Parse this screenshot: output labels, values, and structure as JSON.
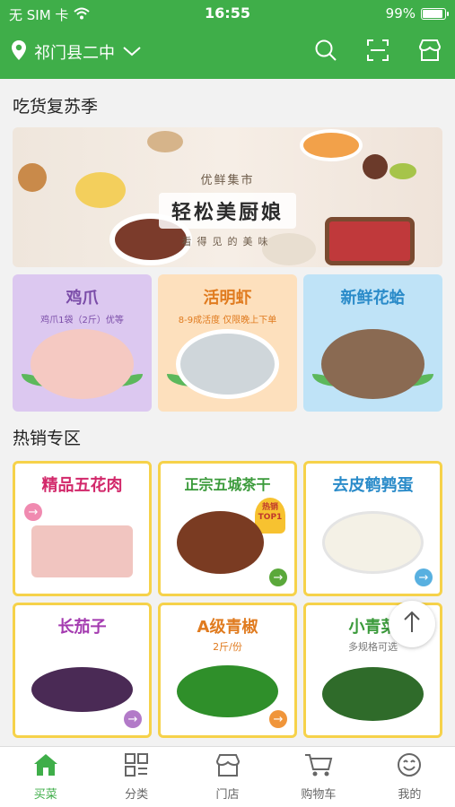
{
  "status_bar": {
    "carrier": "无 SIM 卡",
    "time": "16:55",
    "battery": "99%"
  },
  "header": {
    "location": "祁门县二中"
  },
  "sections": {
    "recommend_title": "吃货复苏季",
    "hot_title": "热销专区"
  },
  "banner": {
    "brand": "优鲜集市",
    "tagline": "轻松美厨娘",
    "subtitle": "看得见的美味"
  },
  "promos": [
    {
      "title": "鸡爪",
      "subtitle": "鸡爪1袋（2斤）优等"
    },
    {
      "title": "活明虾",
      "subtitle": "8-9成活度  仅限晚上下单"
    },
    {
      "title": "新鲜花蛤",
      "subtitle": ""
    }
  ],
  "hot_products": [
    {
      "title": "精品五花肉",
      "subtitle": ""
    },
    {
      "title": "正宗五城茶干",
      "subtitle": "",
      "badge": "热销TOP1"
    },
    {
      "title": "去皮鹌鹑蛋",
      "subtitle": ""
    },
    {
      "title": "长茄子",
      "subtitle": ""
    },
    {
      "title": "A级青椒",
      "subtitle": "2斤/份"
    },
    {
      "title": "小青菜",
      "subtitle": "多规格可选"
    }
  ],
  "tabs": [
    {
      "label": "买菜",
      "icon": "home-icon"
    },
    {
      "label": "分类",
      "icon": "grid-icon"
    },
    {
      "label": "门店",
      "icon": "store-icon"
    },
    {
      "label": "购物车",
      "icon": "cart-icon"
    },
    {
      "label": "我的",
      "icon": "smile-icon"
    }
  ],
  "colors": {
    "brand_green": "#3fae49",
    "card_border": "#f6d24a",
    "promo1_bg": "#dcc8f0",
    "promo2_bg": "#fde0bd",
    "promo3_bg": "#bfe3f7"
  }
}
